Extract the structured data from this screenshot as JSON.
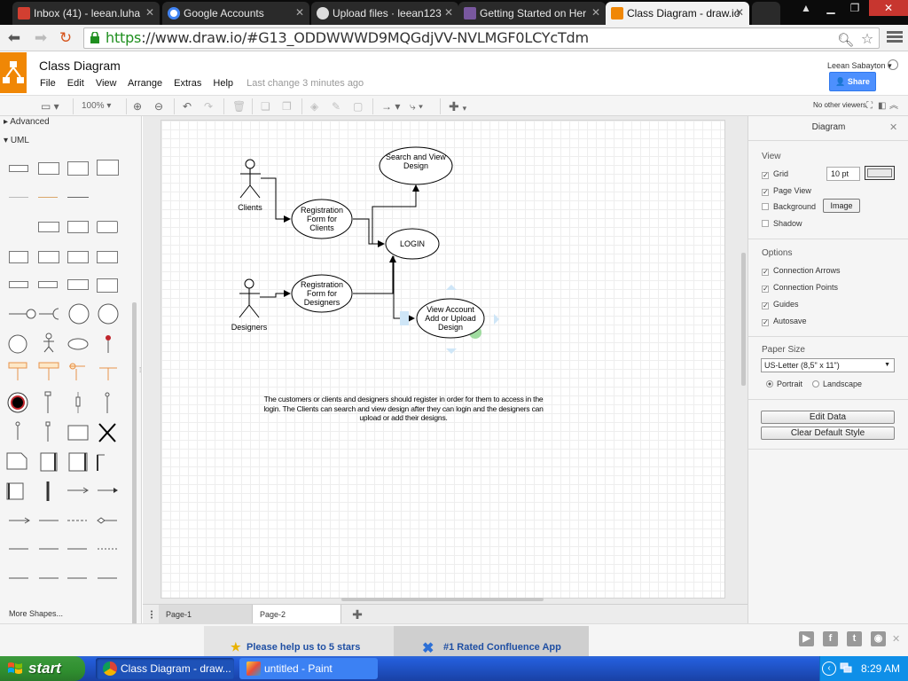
{
  "browser": {
    "tabs": [
      {
        "label": "Inbox (41) - leean.luha",
        "icon": "gmail-icon"
      },
      {
        "label": "Google Accounts",
        "icon": "google-icon"
      },
      {
        "label": "Upload files · leean123",
        "icon": "github-icon"
      },
      {
        "label": "Getting Started on Her",
        "icon": "heroku-icon"
      },
      {
        "label": "Class Diagram - draw.io",
        "icon": "drawio-icon"
      }
    ],
    "url_scheme": "https",
    "url_rest": "://www.draw.io/#G13_ODDWWWD9MQGdjVV-NVLMGF0LCYcTdm"
  },
  "app": {
    "title": "Class Diagram",
    "menus": [
      "File",
      "Edit",
      "View",
      "Arrange",
      "Extras",
      "Help"
    ],
    "last_change": "Last change 3 minutes ago",
    "user": "Leean Sabayton",
    "share_label": "Share"
  },
  "toolbar": {
    "zoom": "100%",
    "viewers": "No other viewers"
  },
  "sidebar": {
    "advanced_label": "Advanced",
    "uml_label": "UML",
    "more_shapes": "More Shapes..."
  },
  "diagram": {
    "actors": {
      "clients": "Clients",
      "designers": "Designers"
    },
    "usecases": {
      "search": [
        "Search and View",
        "Design"
      ],
      "reg_clients": [
        "Registration",
        "Form for",
        "Clients"
      ],
      "login": [
        "LOGIN"
      ],
      "reg_designers": [
        "Registration",
        "Form for",
        "Designers"
      ],
      "view_account": [
        "View Account",
        "Add or Upload",
        "Design"
      ]
    },
    "note": [
      "The customers or clients and designers should register in order for them to access in the",
      "login. The Clients can search and view design after they can login and the designers can",
      "upload or add their designs."
    ]
  },
  "pages": {
    "page1": "Page-1",
    "page2": "Page-2"
  },
  "format_panel": {
    "title": "Diagram",
    "view_head": "View",
    "grid": {
      "label": "Grid",
      "checked": true,
      "size": "10 pt"
    },
    "page_view": {
      "label": "Page View",
      "checked": true
    },
    "background": {
      "label": "Background",
      "checked": false,
      "button": "Image"
    },
    "shadow": {
      "label": "Shadow",
      "checked": false
    },
    "options_head": "Options",
    "options": [
      {
        "label": "Connection Arrows",
        "checked": true
      },
      {
        "label": "Connection Points",
        "checked": true
      },
      {
        "label": "Guides",
        "checked": true
      },
      {
        "label": "Autosave",
        "checked": true
      }
    ],
    "paper_head": "Paper Size",
    "paper_size": "US-Letter (8,5\" x 11\")",
    "portrait": "Portrait",
    "landscape": "Landscape",
    "orientation": "portrait",
    "edit_data": "Edit Data",
    "clear_style": "Clear Default Style"
  },
  "adbar": {
    "rate": "Please help us to 5 stars",
    "confluence": "#1 Rated Confluence App"
  },
  "taskbar": {
    "start": "start",
    "tasks": [
      {
        "label": "Class Diagram - draw...",
        "icon": "chrome-icon"
      },
      {
        "label": "untitled - Paint",
        "icon": "paint-icon"
      }
    ],
    "clock": "8:29 AM"
  },
  "colors": {
    "drawio_orange": "#f08705",
    "share_blue": "#4d90fe",
    "selection_blue": "#29b6f2",
    "xp_taskbar": "#245edb",
    "xp_start_green": "#3c9a3c"
  }
}
